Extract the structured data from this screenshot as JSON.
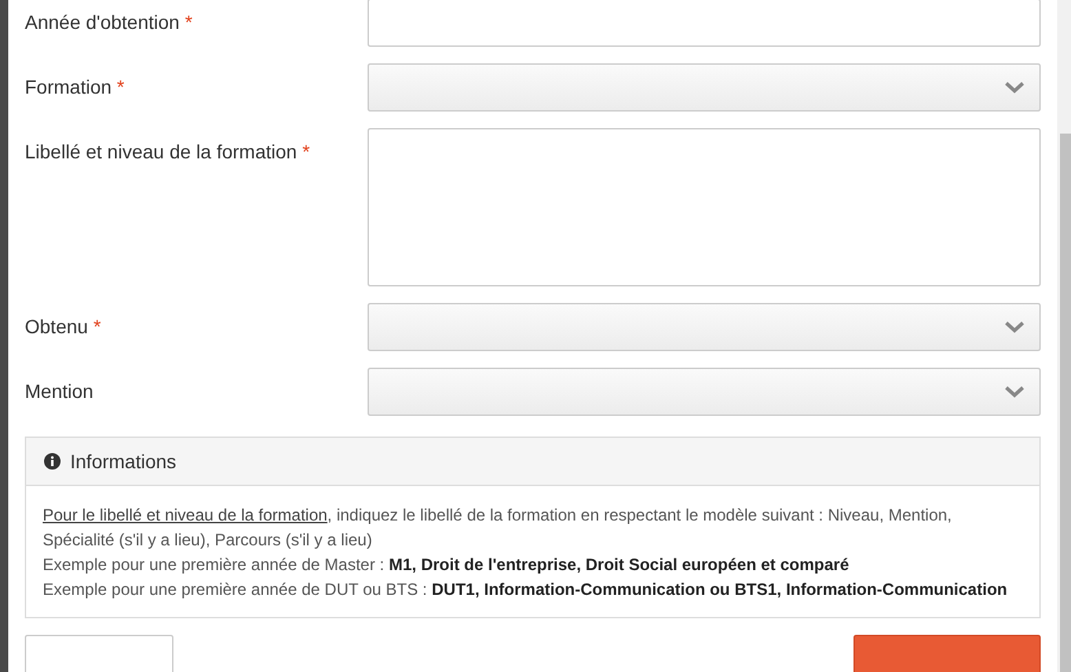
{
  "form": {
    "fields": [
      {
        "kind": "text",
        "label": "Année d'obtention",
        "required_mark": "*"
      },
      {
        "kind": "select",
        "label": "Formation",
        "required_mark": "*"
      },
      {
        "kind": "textarea",
        "label": "Libellé et niveau de la formation",
        "required_mark": "*"
      },
      {
        "kind": "select",
        "label": "Obtenu",
        "required_mark": "*"
      },
      {
        "kind": "select",
        "label": "Mention"
      }
    ]
  },
  "info_panel": {
    "title": "Informations",
    "intro": {
      "link": "Pour le libellé et niveau de la formation",
      "text": ", indiquez le libellé de la formation en respectant le modèle suivant : Niveau, Mention, Spécialité (s'il y a lieu), Parcours (s'il y a lieu)"
    },
    "examples": [
      "Exemple pour une première année de Master : **M1, Droit de l'entreprise, Droit Social européen et comparé**",
      "Exemple pour une première année de DUT ou BTS : **DUT1, Information-Communication ou BTS1, Information-Communication**"
    ]
  },
  "buttons": [
    {
      "kind": "secondary"
    },
    {
      "kind": "primary"
    }
  ]
}
